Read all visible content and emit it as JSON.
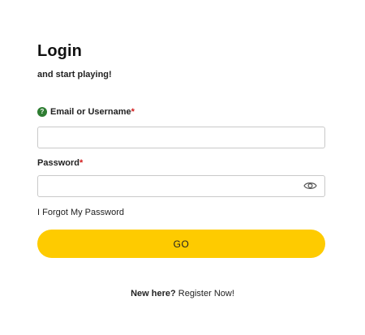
{
  "header": {
    "title": "Login",
    "subtitle": "and start playing!"
  },
  "form": {
    "email": {
      "label": "Email or Username",
      "required_marker": "*",
      "info_icon": "question-icon",
      "value": "",
      "placeholder": ""
    },
    "password": {
      "label": "Password",
      "required_marker": "*",
      "value": "",
      "placeholder": "",
      "toggle_icon": "eye-icon"
    },
    "forgot_link": "I Forgot My Password",
    "submit_label": "GO"
  },
  "footer": {
    "new_here": "New here?",
    "register_link": "Register Now!"
  },
  "colors": {
    "accent": "#fecb00",
    "required": "#d11a1a",
    "info_icon": "#2e7d32"
  }
}
